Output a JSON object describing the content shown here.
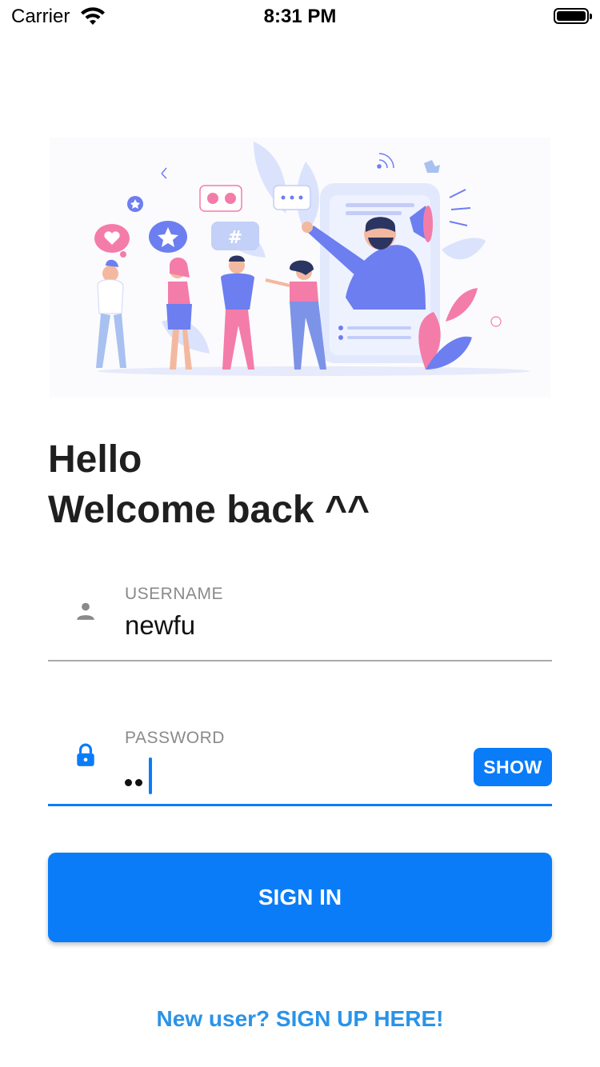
{
  "status_bar": {
    "carrier": "Carrier",
    "time": "8:31 PM",
    "icons": [
      "wifi-icon",
      "battery-icon"
    ]
  },
  "illustration": {
    "kind": "people-social-media-illustration",
    "icons": [
      "heart-bubble-icon",
      "star-bubble-icon",
      "hashtag-bubble-icon",
      "emoji-bubble-icon",
      "chat-dots-bubble-icon",
      "megaphone-icon",
      "signal-icon",
      "thumbs-up-icon"
    ]
  },
  "greeting": {
    "line1": "Hello",
    "line2": "Welcome back ^^"
  },
  "username": {
    "label": "USERNAME",
    "value": "newfu",
    "icon": "person-icon"
  },
  "password": {
    "label": "PASSWORD",
    "masked_length": 2,
    "icon": "lock-icon",
    "show_label": "SHOW"
  },
  "signin": {
    "label": "SIGN IN"
  },
  "signup": {
    "label": "New user? SIGN UP HERE!"
  },
  "colors": {
    "accent": "#0a7cf8",
    "link": "#2a93e8",
    "underline_inactive": "#aaaaaa",
    "illus_blue": "#6c7ef0",
    "illus_pink": "#f47ca8",
    "illus_light": "#dbe3fc"
  }
}
